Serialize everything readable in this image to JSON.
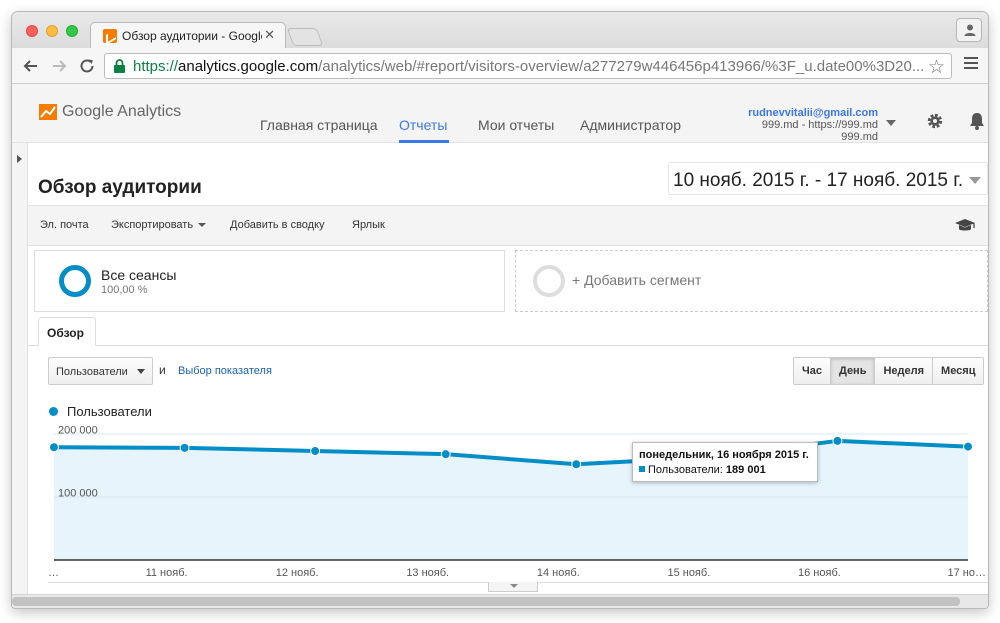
{
  "browser": {
    "tab_title": "Обзор аудитории - Google Analytics",
    "tab_close": "✕",
    "url_scheme": "https://",
    "url_host": "analytics.google.com",
    "url_path": "/analytics/web/#report/visitors-overview/a277279w446456p413966/%3F_u.date00%3D20...",
    "star": "☆"
  },
  "header": {
    "logo_text": "Google Analytics",
    "nav": [
      {
        "label": "Главная страница"
      },
      {
        "label": "Отчеты"
      },
      {
        "label": "Мои отчеты"
      },
      {
        "label": "Администратор"
      }
    ],
    "account": {
      "email": "rudnevvitalii@gmail.com",
      "property": "999.md - https://999.md",
      "view": "999.md"
    }
  },
  "report": {
    "title": "Обзор аудитории",
    "date_range": "10 нояб. 2015 г. - 17 нояб. 2015 г.",
    "actions": {
      "email": "Эл. почта",
      "export": "Экспортировать",
      "add_dashboard": "Добавить в сводку",
      "shortcut": "Ярлык"
    },
    "segment": {
      "name": "Все сеансы",
      "percent": "100,00 %"
    },
    "add_segment": "+ Добавить сегмент",
    "tab": "Обзор",
    "metric_select": "Пользователи",
    "and_label": "и",
    "choose_metric": "Выбор показателя",
    "periods": [
      {
        "label": "Час"
      },
      {
        "label": "День"
      },
      {
        "label": "Неделя"
      },
      {
        "label": "Месяц"
      }
    ],
    "legend": "Пользователи",
    "tooltip": {
      "title": "понедельник, 16 ноября 2015 г.",
      "series": "Пользователи:",
      "value": "189 001"
    }
  },
  "colors": {
    "series": "#058dc7",
    "area": "#e6f4fb",
    "accent": "#3b78e7"
  },
  "chart_data": {
    "type": "area",
    "categories": [
      "…",
      "11 нояб.",
      "12 нояб.",
      "13 нояб.",
      "14 нояб.",
      "15 нояб.",
      "16 нояб.",
      "17 но…"
    ],
    "series": [
      {
        "name": "Пользователи",
        "values": [
          179000,
          178000,
          173000,
          168000,
          152000,
          163000,
          189000,
          180000
        ]
      }
    ],
    "ytick_labels": [
      "200 000",
      "100 000"
    ],
    "yticks": [
      200000,
      100000
    ],
    "ylim": [
      0,
      200000
    ],
    "grid": true
  }
}
